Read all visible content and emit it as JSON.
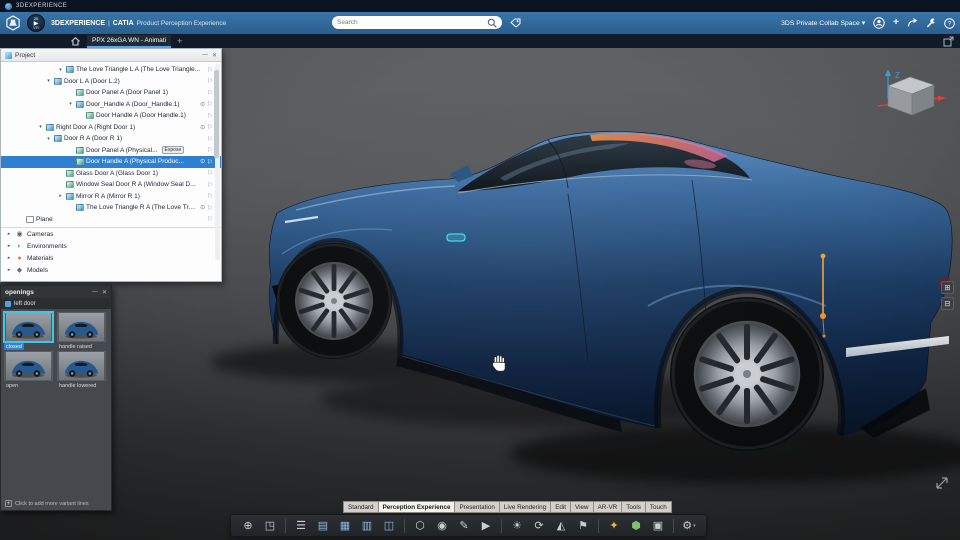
{
  "titlebar": {
    "app_name": "3DEXPERIENCE"
  },
  "header": {
    "platform": "3DEXPERIENCE",
    "divider": "|",
    "app": "CATIA",
    "product": "Product Perception Experience",
    "compass": {
      "top": "20",
      "bottom": "V.R"
    },
    "search": {
      "placeholder": "Search"
    },
    "collab": {
      "label": "3DS Private Collab Space",
      "caret": "▾"
    },
    "add_label": "+"
  },
  "tabbar": {
    "doc_tab": "PPX 26xGA WN - Animati",
    "new_tab": "+"
  },
  "icons": {
    "arrow_down": "▾",
    "arrow_right": "▸",
    "eye": "⊙",
    "flag": "⚐"
  },
  "project_panel": {
    "title": "Project",
    "min_glyph": "—",
    "close_glyph": "✕",
    "tree": [
      {
        "label": "The Love Triangle L A (The Love Triangle...",
        "pad": 56,
        "arrow": "arrow_down",
        "icon": "asm"
      },
      {
        "label": "Door L A (Door L.2)",
        "pad": 44,
        "arrow": "arrow_down",
        "icon": "asm"
      },
      {
        "label": "Door Panel A (Door Panel 1)",
        "pad": 66,
        "icon": "part"
      },
      {
        "label": "Door_Handle A (Door_Handle.1)",
        "pad": 66,
        "arrow": "arrow_down",
        "icon": "asm",
        "eye": true
      },
      {
        "label": "Door Handle A (Door Handle.1)",
        "pad": 76,
        "icon": "part"
      },
      {
        "label": "Right Door A (Right Door 1)",
        "pad": 36,
        "arrow": "arrow_down",
        "icon": "asm",
        "eye": true
      },
      {
        "label": "Door R A (Door R 1)",
        "pad": 44,
        "arrow": "arrow_down",
        "icon": "asm"
      },
      {
        "label": "Door Panel A (Physical...",
        "pad": 66,
        "icon": "part",
        "badge": "Expose"
      },
      {
        "label": "Door Handle A (Physical Produc...",
        "pad": 66,
        "icon": "part",
        "selected": true,
        "eye": true
      },
      {
        "label": "Glass Door A (Glass Door 1)",
        "pad": 56,
        "icon": "part"
      },
      {
        "label": "Window Seal Door R A (Window Seal D...",
        "pad": 56,
        "icon": "part"
      },
      {
        "label": "Mirror R A (Mirror R 1)",
        "pad": 56,
        "arrow": "arrow_right",
        "icon": "asm"
      },
      {
        "label": "The Love Triangle R A (The Love Triangle...",
        "pad": 66,
        "icon": "asm",
        "eye": true
      },
      {
        "label": "Plane",
        "pad": 16,
        "icon": "plane"
      }
    ],
    "sections": [
      {
        "label": "Cameras",
        "glyph": "◉",
        "color": "#5a6066"
      },
      {
        "label": "Environments",
        "glyph": "◐",
        "color": "#4a90c4"
      },
      {
        "label": "Materials",
        "glyph": "●",
        "color": "#e07b2a"
      },
      {
        "label": "Models",
        "glyph": "◆",
        "color": "#6a7076"
      }
    ]
  },
  "openings_panel": {
    "title": "openings",
    "min_glyph": "—",
    "close_glyph": "✕",
    "group_label": "left door",
    "variants": [
      {
        "label": "closed",
        "selected": true
      },
      {
        "label": "handle raised"
      },
      {
        "label": "open"
      },
      {
        "label": "handle lowered"
      }
    ],
    "footer_plus": "+",
    "footer": "Click to add more variant lines"
  },
  "viewport": {
    "triad": {
      "z": "Z"
    },
    "side_buttons": [
      {
        "glyph": "⊞",
        "name": "expand-viewport-button"
      },
      {
        "glyph": "⊟",
        "name": "collapse-viewport-button"
      }
    ]
  },
  "bottom_tabs": {
    "active": "Perception Experience",
    "tabs": [
      "Standard",
      "Perception Experience",
      "Presentation",
      "Live Rendering",
      "Edit",
      "View",
      "AR-VR",
      "Tools",
      "Touch"
    ]
  },
  "toolbar": {
    "caret": "▾",
    "items": [
      {
        "glyph": "⊕",
        "name": "zoom-area-icon"
      },
      {
        "glyph": "◳",
        "name": "iso-view-icon"
      },
      {
        "sep": true
      },
      {
        "glyph": "☰",
        "name": "spec-tree-icon"
      },
      {
        "glyph": "▤",
        "name": "layout-rows-icon",
        "tint": "#8ab8e2"
      },
      {
        "glyph": "▦",
        "name": "layout-grid-icon",
        "tint": "#8ab8e2"
      },
      {
        "glyph": "▥",
        "name": "layout-columns-icon",
        "tint": "#8ab8e2"
      },
      {
        "glyph": "◫",
        "name": "layout-split-icon",
        "tint": "#8ab8e2"
      },
      {
        "sep": true
      },
      {
        "glyph": "⬡",
        "name": "product-context-icon"
      },
      {
        "glyph": "◉",
        "name": "material-preview-icon"
      },
      {
        "glyph": "✎",
        "name": "sketch-icon"
      },
      {
        "glyph": "▶",
        "name": "play-animation-icon"
      },
      {
        "sep": true
      },
      {
        "glyph": "☀",
        "name": "ambience-light-icon"
      },
      {
        "glyph": "⟳",
        "name": "turntable-icon"
      },
      {
        "glyph": "◭",
        "name": "section-view-icon"
      },
      {
        "glyph": "⚑",
        "name": "milestone-flag-icon"
      },
      {
        "sep": true
      },
      {
        "glyph": "✦",
        "name": "effects-icon",
        "tint": "#e2bd4e"
      },
      {
        "glyph": "⬢",
        "name": "render-quality-icon",
        "tint": "#7cc06e"
      },
      {
        "glyph": "▣",
        "name": "capture-icon"
      },
      {
        "sep": true
      },
      {
        "glyph": "⚙",
        "name": "settings-gear-icon",
        "caret": true
      }
    ]
  }
}
